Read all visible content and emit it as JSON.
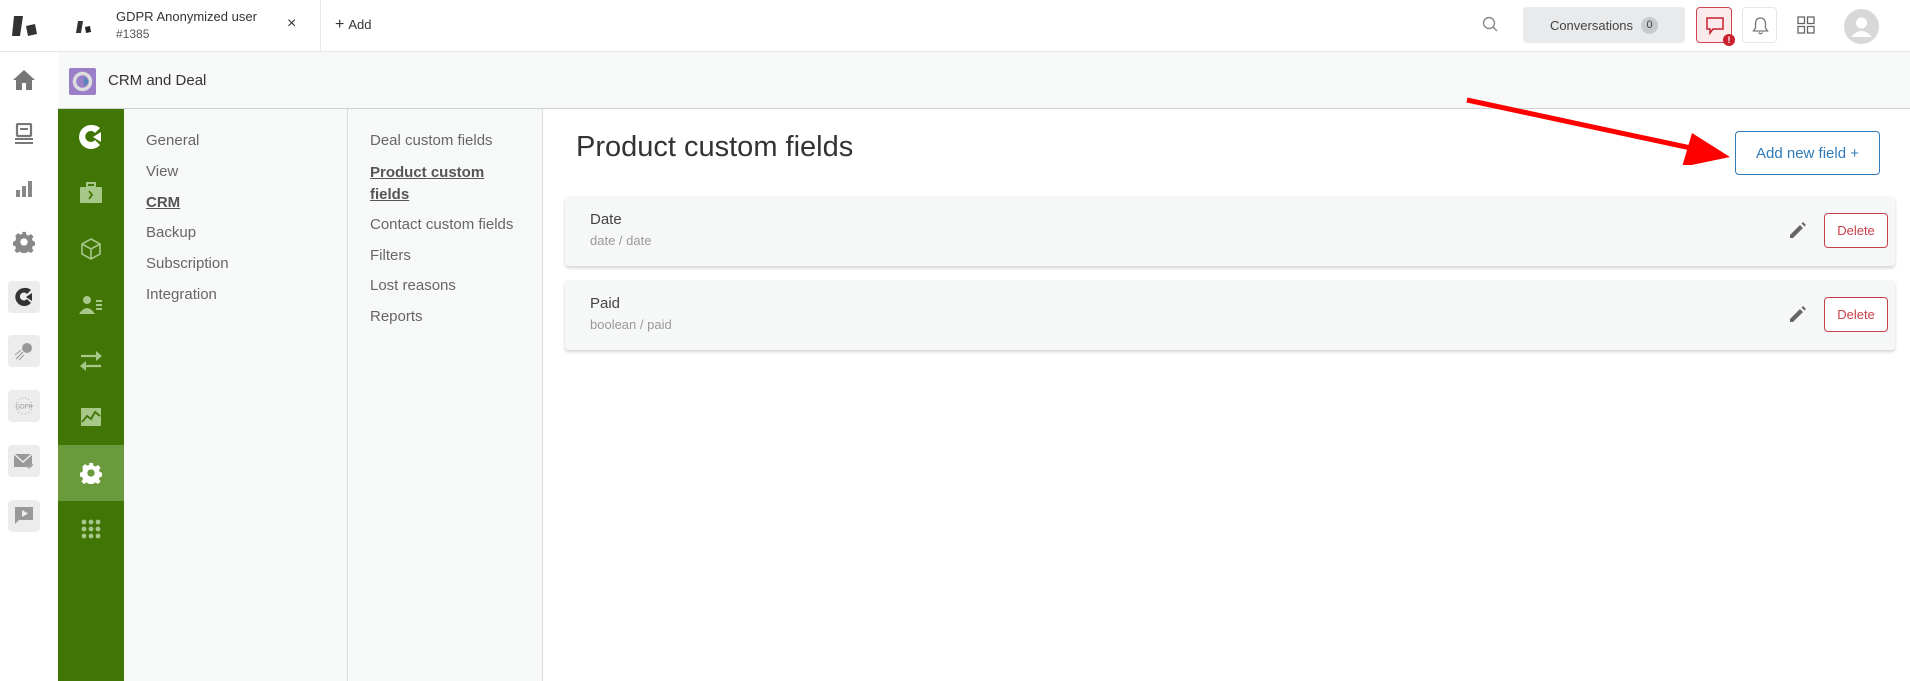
{
  "topbar": {
    "tab": {
      "title": "GDPR Anonymized user",
      "subtitle": "#1385",
      "close": "×"
    },
    "add_tab_label": "Add",
    "add_tab_icon": "+",
    "conversations_label": "Conversations",
    "conversations_count": "0",
    "chat_alert": "!"
  },
  "app": {
    "title": "CRM and Deal"
  },
  "nav_primary": [
    {
      "label": "General",
      "active": false
    },
    {
      "label": "View",
      "active": false
    },
    {
      "label": "CRM",
      "active": true
    },
    {
      "label": "Backup",
      "active": false
    },
    {
      "label": "Subscription",
      "active": false
    },
    {
      "label": "Integration",
      "active": false
    }
  ],
  "nav_secondary": [
    {
      "label": "Deal custom fields",
      "active": false
    },
    {
      "label": "Product custom fields",
      "active": true
    },
    {
      "label": "Contact custom fields",
      "active": false
    },
    {
      "label": "Filters",
      "active": false
    },
    {
      "label": "Lost reasons",
      "active": false
    },
    {
      "label": "Reports",
      "active": false
    }
  ],
  "main": {
    "title": "Product custom fields",
    "add_button": "Add new field +",
    "fields": [
      {
        "name": "Date",
        "meta": "date / date",
        "delete_label": "Delete"
      },
      {
        "name": "Paid",
        "meta": "boolean / paid",
        "delete_label": "Delete"
      }
    ]
  },
  "colors": {
    "sidebar_green": "#417505",
    "sidebar_active": "#6a9a3c",
    "primary_blue": "#2f7ab8",
    "danger_red": "#c8404a",
    "annotation_arrow": "#ff0000"
  }
}
